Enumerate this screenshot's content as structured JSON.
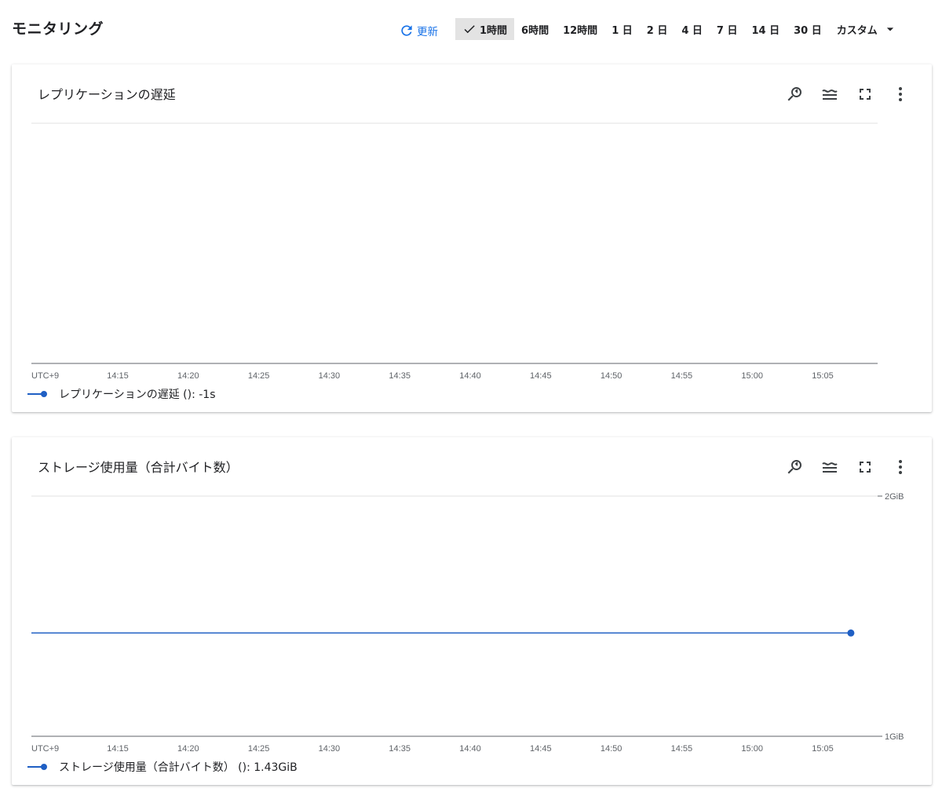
{
  "page": {
    "title": "モニタリング"
  },
  "toolbar": {
    "refresh_label": "更新",
    "ranges": [
      "1時間",
      "6時間",
      "12時間",
      "1 日",
      "2 日",
      "4 日",
      "7 日",
      "14 日",
      "30 日"
    ],
    "selected_range": "1時間",
    "custom_label": "カスタム"
  },
  "colors": {
    "accent": "#1a73e8",
    "series": "#1f5fc4",
    "axis": "#5f6368",
    "grid": "#e0e0e0"
  },
  "icons": [
    "zoom-reset-icon",
    "legend-toggle-icon",
    "fullscreen-icon",
    "more-vert-icon"
  ],
  "charts": [
    {
      "title": "レプリケーションの遅延",
      "legend": "レプリケーションの遅延 (): -1s",
      "chart_data": {
        "type": "line",
        "title": "レプリケーションの遅延",
        "x_ticks": [
          "UTC+9",
          "14:15",
          "14:20",
          "14:25",
          "14:30",
          "14:35",
          "14:40",
          "14:45",
          "14:50",
          "14:55",
          "15:00",
          "15:05"
        ],
        "y_ticks": [],
        "series": [
          {
            "name": "レプリケーションの遅延 ()",
            "x": [],
            "y": []
          }
        ],
        "grid": true,
        "legend": "bottom-left"
      }
    },
    {
      "title": "ストレージ使用量（合計バイト数）",
      "legend": "ストレージ使用量（合計バイト数） (): 1.43GiB",
      "chart_data": {
        "type": "line",
        "title": "ストレージ使用量（合計バイト数）",
        "x_ticks": [
          "UTC+9",
          "14:15",
          "14:20",
          "14:25",
          "14:30",
          "14:35",
          "14:40",
          "14:45",
          "14:50",
          "14:55",
          "15:00",
          "15:05"
        ],
        "y_ticks": [
          "2GiB",
          "1GiB"
        ],
        "ylim": [
          1,
          2
        ],
        "y_unit": "GiB",
        "series": [
          {
            "name": "ストレージ使用量（合計バイト数） ()",
            "x": [
              "14:09",
              "15:07"
            ],
            "y": [
              1.43,
              1.43
            ],
            "end_marker": true
          }
        ],
        "grid": true,
        "legend": "bottom-left"
      }
    }
  ]
}
